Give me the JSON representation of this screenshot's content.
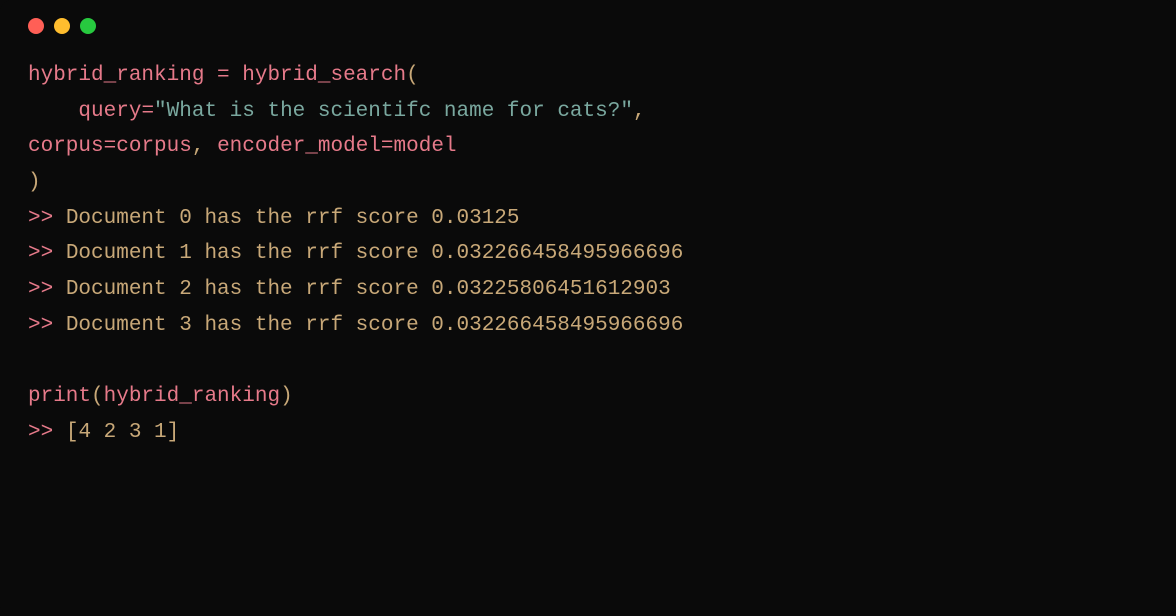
{
  "window": {
    "controls": [
      "close",
      "minimize",
      "maximize"
    ]
  },
  "code": {
    "line1": {
      "var": "hybrid_ranking",
      "op": " = ",
      "func": "hybrid_search",
      "paren": "("
    },
    "line2": {
      "indent": "    ",
      "param": "query",
      "eq": "=",
      "string": "\"What is the scientifc name for cats?\"",
      "comma": ","
    },
    "line3": {
      "param1": "corpus",
      "eq1": "=",
      "val1": "corpus",
      "comma1": ",",
      "space": " ",
      "param2": "encoder_model",
      "eq2": "=",
      "val2": "model"
    },
    "line4": {
      "paren": ")"
    },
    "output_lines": [
      {
        "prompt": ">>",
        "text": " Document 0 has the rrf score 0.03125"
      },
      {
        "prompt": ">>",
        "text": " Document 1 has the rrf score 0.032266458495966696"
      },
      {
        "prompt": ">>",
        "text": " Document 2 has the rrf score 0.03225806451612903"
      },
      {
        "prompt": ">>",
        "text": " Document 3 has the rrf score 0.032266458495966696"
      }
    ],
    "print_line": {
      "func": "print",
      "paren_open": "(",
      "arg": "hybrid_ranking",
      "paren_close": ")"
    },
    "result_line": {
      "prompt": ">>",
      "space": " ",
      "bracket_open": "[",
      "values": "4 2 3 1",
      "bracket_close": "]"
    }
  }
}
